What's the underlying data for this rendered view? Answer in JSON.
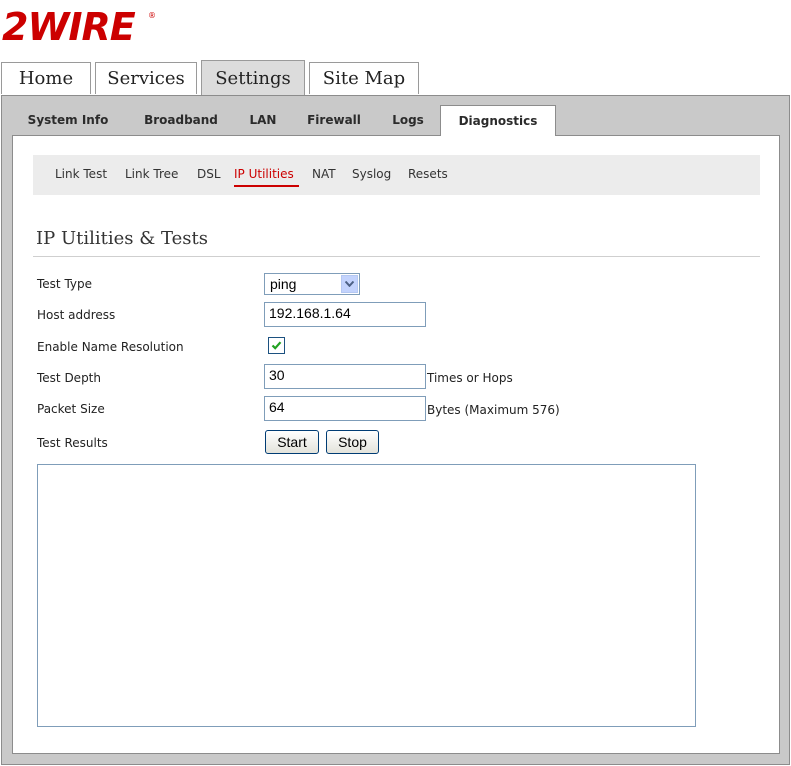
{
  "brand": {
    "logo_text": "2WIRE",
    "logo_color": "#cc0000"
  },
  "top_tabs": [
    {
      "label": "Home",
      "active": false
    },
    {
      "label": "Services",
      "active": false
    },
    {
      "label": "Settings",
      "active": true
    },
    {
      "label": "Site Map",
      "active": false
    }
  ],
  "sub_tabs": [
    {
      "label": "System Info",
      "active": false
    },
    {
      "label": "Broadband",
      "active": false
    },
    {
      "label": "LAN",
      "active": false
    },
    {
      "label": "Firewall",
      "active": false
    },
    {
      "label": "Logs",
      "active": false
    },
    {
      "label": "Diagnostics",
      "active": true
    }
  ],
  "diag_nav": [
    {
      "label": "Link Test",
      "active": false
    },
    {
      "label": "Link Tree",
      "active": false
    },
    {
      "label": "DSL",
      "active": false
    },
    {
      "label": "IP Utilities",
      "active": true
    },
    {
      "label": "NAT",
      "active": false
    },
    {
      "label": "Syslog",
      "active": false
    },
    {
      "label": "Resets",
      "active": false
    }
  ],
  "section": {
    "title": "IP Utilities & Tests"
  },
  "form": {
    "test_type": {
      "label": "Test Type",
      "value": "ping"
    },
    "host_address": {
      "label": "Host address",
      "value": "192.168.1.64"
    },
    "name_resolution": {
      "label": "Enable Name Resolution",
      "checked": true
    },
    "test_depth": {
      "label": "Test Depth",
      "value": "30",
      "suffix": "Times or Hops"
    },
    "packet_size": {
      "label": "Packet Size",
      "value": "64",
      "suffix": "Bytes (Maximum 576)"
    },
    "test_results": {
      "label": "Test Results",
      "value": ""
    },
    "start_label": "Start",
    "stop_label": "Stop"
  },
  "colors": {
    "accent": "#cc0000",
    "frame_gray": "#c9c9c9",
    "subnav_bg": "#ececec"
  }
}
